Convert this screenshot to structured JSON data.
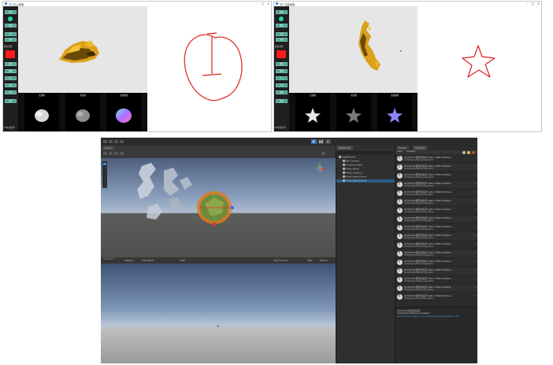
{
  "left_app": {
    "title": "3D 红心画板",
    "toolbar_buttons": [
      "画笔",
      "橡皮",
      "清空",
      "保存",
      "撤销",
      "重做",
      "导入",
      "导出",
      "设置",
      "帮助"
    ],
    "color_label": "颜色选择",
    "status_label": "3D生成完毕",
    "thumb_labels": [
      "法线图",
      "深度图",
      "法线贴图"
    ]
  },
  "right_app": {
    "title": "3D 五星画板",
    "toolbar_buttons": [
      "画笔",
      "橡皮",
      "清空",
      "保存",
      "撤销",
      "重做",
      "导入",
      "导出",
      "设置",
      "帮助"
    ],
    "color_label": "颜色选择",
    "status_label": "3D生成完毕",
    "thumb_labels": [
      "法线图",
      "深度图",
      "法线贴图"
    ]
  },
  "unity": {
    "scene_tab": "Scene",
    "game_tab": "Game",
    "hierarchy_tab": "Hierarchy",
    "project_tab": "Project",
    "console_tab": "Console",
    "game_display": "Display 1",
    "game_aspect": "Free Aspect",
    "game_scale": "Scale",
    "game_maximize": "Play Focused",
    "game_stats": "Stats",
    "game_gizmos": "Gizmos",
    "console_clear": "Clear",
    "console_collapse": "Collapse",
    "hierarchy_items": [
      "SampleScene",
      "Main Camera",
      "Directional Light",
      "Model_sketch",
      "Model_sketch(1)",
      "Model_sketch(Clone)",
      "Model_sketch(Clone)"
    ],
    "console_messages": [
      {
        "l1": "[10:00:21] 模型生成完毕 path: 0.000.0 Vertices",
        "l2": "UnityEngine.Debug:Log(object)",
        "count": "1"
      },
      {
        "l1": "[10:00:22] 模型生成完毕 path: 0.000.0 Vertices",
        "l2": "UnityEngine.Debug:Log(object)",
        "count": "1"
      },
      {
        "l1": "[10:00:23] 模型生成完毕 path: 0.000.0 Vertices",
        "l2": "UnityEngine.Debug:Log(object)",
        "count": "1"
      },
      {
        "l1": "[10:00:24] 模型生成完毕 path: 0.000.0 Vertices",
        "l2": "UnityEngine.Debug:Log(object)",
        "count": "1"
      },
      {
        "l1": "[10:00:25] 模型生成完毕 path: 0.000.0 Vertices",
        "l2": "UnityEngine.Debug:Log(object)",
        "count": "1"
      },
      {
        "l1": "[10:00:26] 模型生成完毕 path: 0.000.0 Vertices",
        "l2": "UnityEngine.Debug:Log(object)",
        "count": "1"
      },
      {
        "l1": "[10:00:27] 模型生成完毕 path: 0.000.0 Vertices",
        "l2": "UnityEngine.Debug:Log(object)",
        "count": "1"
      },
      {
        "l1": "[10:00:28] 模型生成完毕 path: 0.000.0 Vertices",
        "l2": "UnityEngine.Debug:Log(object)",
        "count": "1"
      },
      {
        "l1": "[10:00:29] 模型生成完毕 path: 0.000.0 Vertices",
        "l2": "UnityEngine.Debug:Log(object)",
        "count": "1"
      },
      {
        "l1": "[10:00:30] 模型生成完毕 path: 0.000.0 Vertices",
        "l2": "UnityEngine.Debug:Log(object)",
        "count": "1"
      },
      {
        "l1": "[10:00:31] 模型生成完毕 path: 0.000.0 Vertices",
        "l2": "UnityEngine.Debug:Log(object)",
        "count": "1"
      },
      {
        "l1": "[10:00:32] 模型生成完毕 path: 0.000.0 Vertices",
        "l2": "UnityEngine.Debug:Log(object)",
        "count": "1"
      },
      {
        "l1": "[10:00:33] 模型生成完毕 path: 0.000.0 Vertices",
        "l2": "UnityEngine.Debug:Log(object)",
        "count": "1"
      },
      {
        "l1": "[10:00:34] 模型生成完毕 path: 0.000.0 Vertices",
        "l2": "UnityEngine.Debug:Log(object)",
        "count": "1"
      },
      {
        "l1": "[10:00:35] 模型生成完毕 path: 0.000.0 Vertices",
        "l2": "UnityEngine.Debug:Log(object)",
        "count": "1"
      },
      {
        "l1": "[10:00:36] 模型生成完毕 path: 0.000.0 Vertices",
        "l2": "UnityEngine.Debug:Log(object)",
        "count": "1"
      },
      {
        "l1": "[10:00:37] 模型生成完毕 path: 0.000.0 Vertices",
        "l2": "UnityEngine.Debug:Log(object)",
        "count": "1"
      }
    ],
    "console_detail_1": "[10:00:37] 模型生成完毕",
    "console_detail_2": "UnityEngine.Debug:Log (object)",
    "console_detail_3": "ModelLoader.Update () (at Assets/Scripts/ModelLoader.cs:42)"
  },
  "colors": {
    "accent_teal": "#4d9e8e",
    "pen_red": "#e02020",
    "selected_color": "#ff1a1a",
    "model_gold": "#d9a21a",
    "unity_dark": "#383838",
    "unity_play_blue": "#3a6fb0"
  }
}
